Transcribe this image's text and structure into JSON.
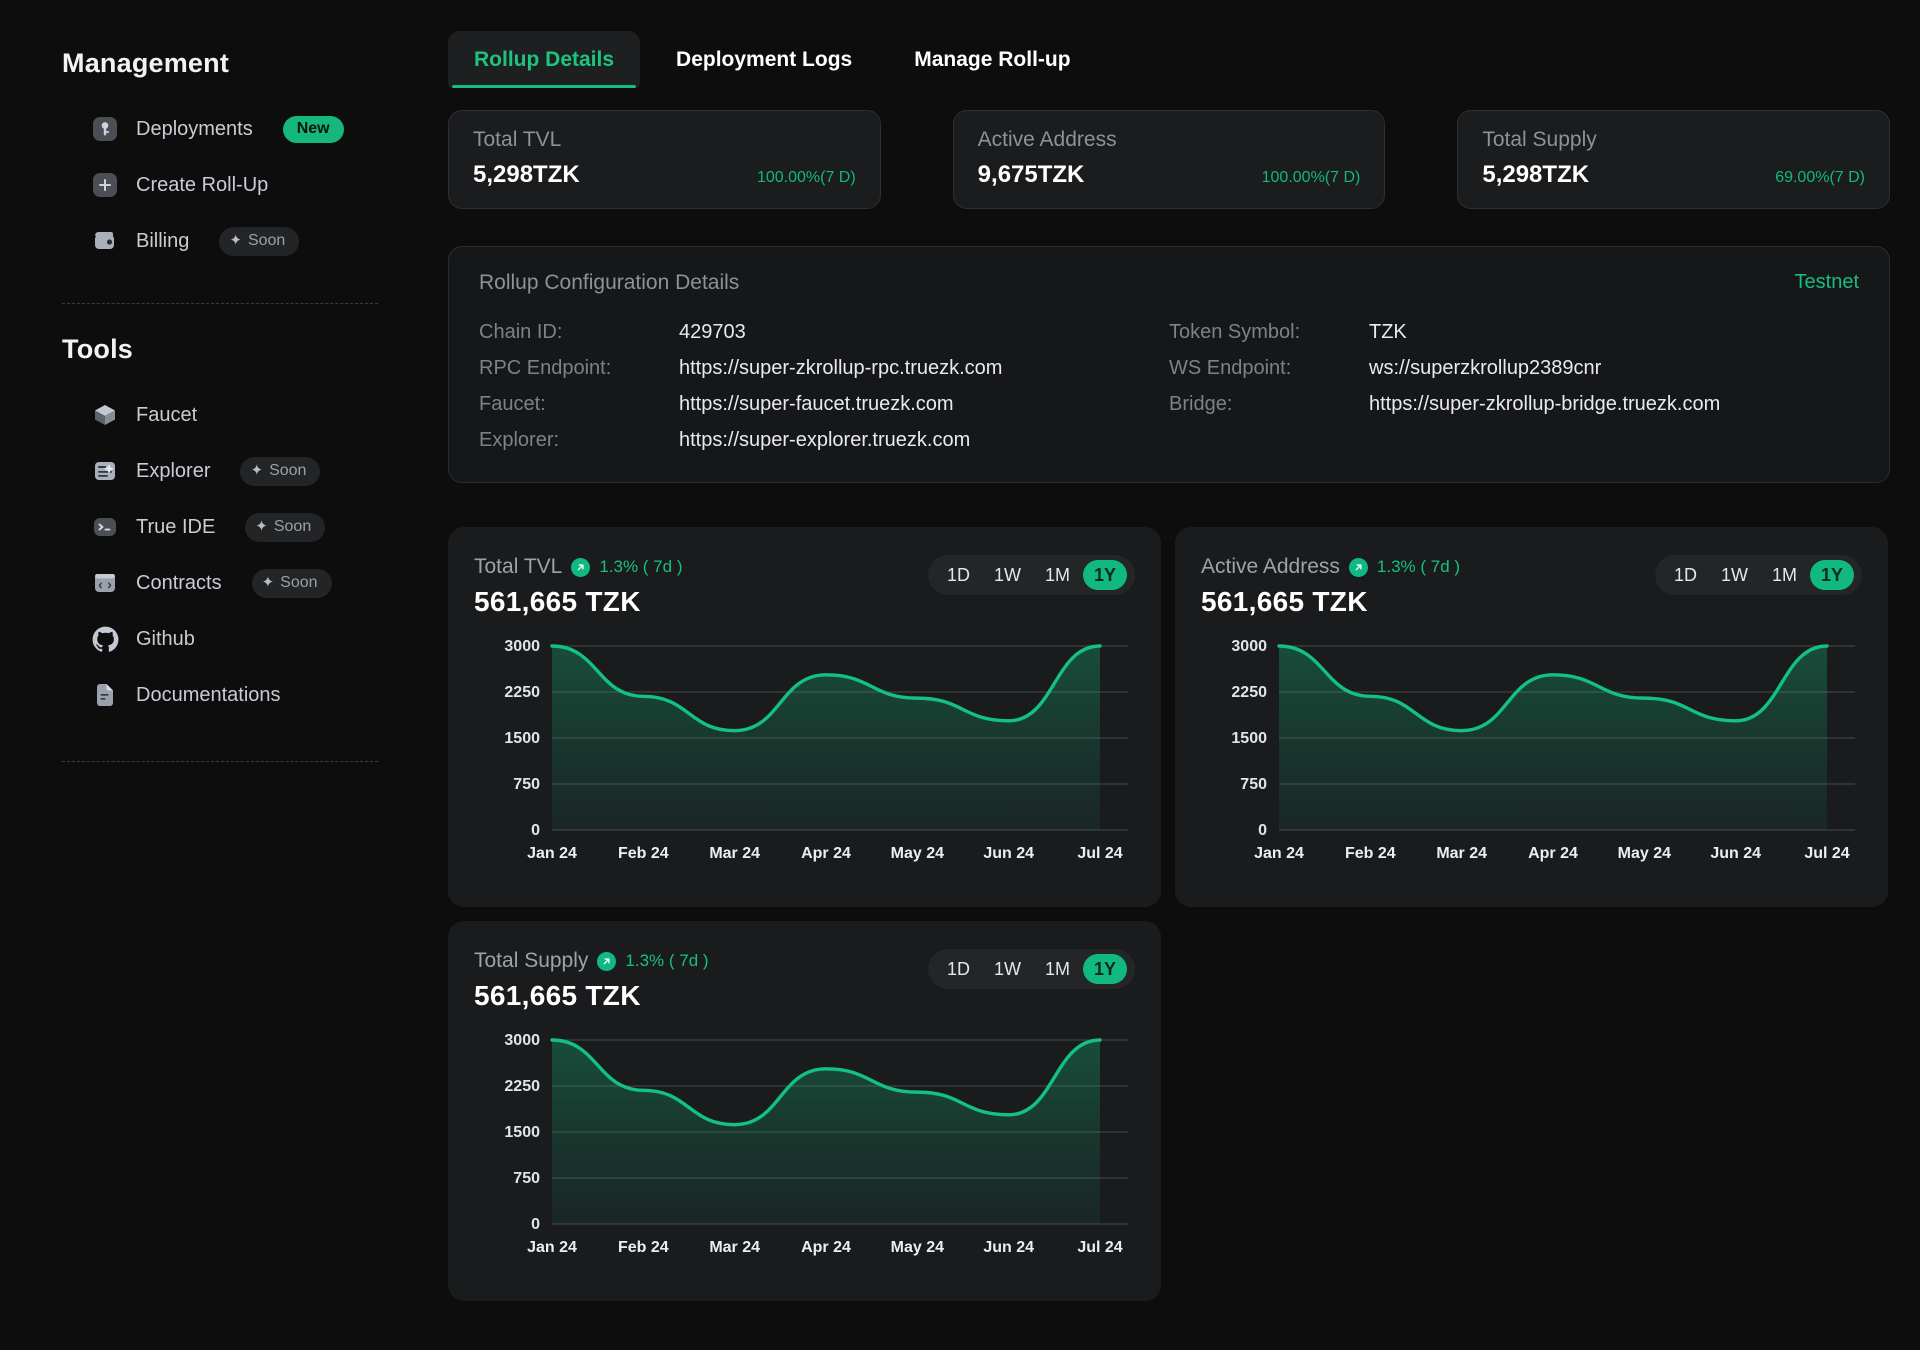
{
  "sidebar": {
    "management_heading": "Management",
    "tools_heading": "Tools",
    "management_items": [
      {
        "label": "Deployments",
        "icon": "key-icon",
        "badge": "New",
        "badge_type": "new"
      },
      {
        "label": "Create Roll-Up",
        "icon": "plus-square-icon",
        "badge": "",
        "badge_type": "none"
      },
      {
        "label": "Billing",
        "icon": "wallet-icon",
        "badge": "Soon",
        "badge_type": "soon"
      }
    ],
    "tools_items": [
      {
        "label": "Faucet",
        "icon": "cube-icon",
        "badge": "",
        "badge_type": "none"
      },
      {
        "label": "Explorer",
        "icon": "explorer-icon",
        "badge": "Soon",
        "badge_type": "soon"
      },
      {
        "label": "True IDE",
        "icon": "terminal-icon",
        "badge": "Soon",
        "badge_type": "soon"
      },
      {
        "label": "Contracts",
        "icon": "contract-icon",
        "badge": "Soon",
        "badge_type": "soon"
      },
      {
        "label": "Github",
        "icon": "github-icon",
        "badge": "",
        "badge_type": "none"
      },
      {
        "label": "Documentations",
        "icon": "document-icon",
        "badge": "",
        "badge_type": "none"
      }
    ]
  },
  "tabs": [
    {
      "label": "Rollup Details",
      "active": true
    },
    {
      "label": "Deployment Logs",
      "active": false
    },
    {
      "label": "Manage Roll-up",
      "active": false
    }
  ],
  "stat_cards": [
    {
      "title": "Total TVL",
      "value": "5,298TZK",
      "pct": "100.00%(7 D)"
    },
    {
      "title": "Active Address",
      "value": "9,675TZK",
      "pct": "100.00%(7 D)"
    },
    {
      "title": "Total Supply",
      "value": "5,298TZK",
      "pct": "69.00%(7 D)"
    }
  ],
  "config": {
    "title": "Rollup Configuration Details",
    "network": "Testnet",
    "left": [
      {
        "key": "Chain ID:",
        "value": "429703"
      },
      {
        "key": "RPC Endpoint:",
        "value": "https://super-zkrollup-rpc.truezk.com"
      },
      {
        "key": "Faucet:",
        "value": "https://super-faucet.truezk.com"
      },
      {
        "key": "Explorer:",
        "value": "https://super-explorer.truezk.com"
      }
    ],
    "right": [
      {
        "key": "Token Symbol:",
        "value": "TZK"
      },
      {
        "key": "WS Endpoint:",
        "value": "ws://superzkrollup2389cnr"
      },
      {
        "key": "Bridge:",
        "value": "https://super-zkrollup-bridge.truezk.com"
      }
    ]
  },
  "ranges": [
    "1D",
    "1W",
    "1M",
    "1Y"
  ],
  "active_range": "1Y",
  "charts": [
    {
      "title": "Total TVL",
      "delta": "1.3% ( 7d )",
      "value": "561,665 TZK"
    },
    {
      "title": "Active Address",
      "delta": "1.3% ( 7d )",
      "value": "561,665 TZK"
    },
    {
      "title": "Total Supply",
      "delta": "1.3% ( 7d )",
      "value": "561,665 TZK"
    }
  ],
  "colors": {
    "accent_green": "#12b77d",
    "line_green": "#13c182",
    "badge_new_bg": "#15b87a",
    "page_bg": "#0d0d0d",
    "card_bg": "#1a1b1d"
  },
  "chart_data": {
    "type": "area",
    "title": "Total TVL",
    "xlabel": "",
    "ylabel": "",
    "ylim": [
      0,
      3000
    ],
    "yticks": [
      0,
      750,
      1500,
      2250,
      3000
    ],
    "grid": true,
    "legend": "none",
    "categories": [
      "Jan 24",
      "Feb 24",
      "Mar 24",
      "Apr 24",
      "May 24",
      "Jun 24",
      "Jul 24"
    ],
    "series": [
      {
        "name": "Total TVL",
        "values": [
          3000,
          2180,
          1620,
          2530,
          2150,
          1780,
          3000
        ]
      },
      {
        "name": "Active Address",
        "values": [
          3000,
          2180,
          1620,
          2530,
          2150,
          1780,
          3000
        ]
      },
      {
        "name": "Total Supply",
        "values": [
          3000,
          2180,
          1620,
          2530,
          2150,
          1780,
          3000
        ]
      }
    ]
  }
}
